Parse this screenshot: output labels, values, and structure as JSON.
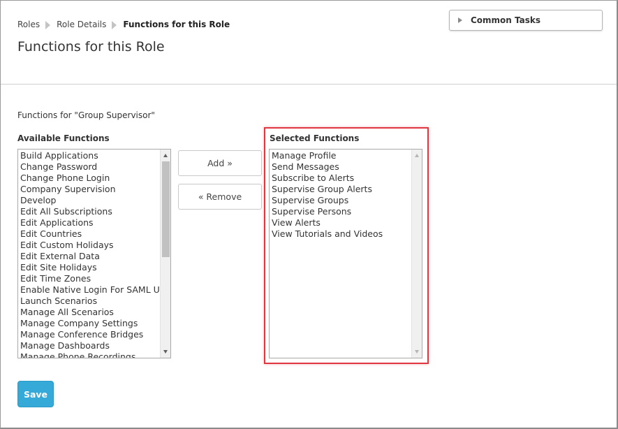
{
  "breadcrumb": {
    "items": [
      "Roles",
      "Role Details"
    ],
    "current": "Functions for this Role"
  },
  "page_title": "Functions for this Role",
  "common_tasks": {
    "label": "Common Tasks"
  },
  "functions_for_label": "Functions for \"Group Supervisor\"",
  "available": {
    "label": "Available Functions",
    "items": [
      "Build Applications",
      "Change Password",
      "Change Phone Login",
      "Company Supervision",
      "Develop",
      "Edit All Subscriptions",
      "Edit Applications",
      "Edit Countries",
      "Edit Custom Holidays",
      "Edit External Data",
      "Edit Site Holidays",
      "Edit Time Zones",
      "Enable Native Login For SAML Users",
      "Launch Scenarios",
      "Manage All Scenarios",
      "Manage Company Settings",
      "Manage Conference Bridges",
      "Manage Dashboards",
      "Manage Phone Recordings"
    ]
  },
  "buttons": {
    "add": "Add »",
    "remove": "« Remove",
    "save": "Save"
  },
  "selected": {
    "label": "Selected Functions",
    "items": [
      "Manage Profile",
      "Send Messages",
      "Subscribe to Alerts",
      "Supervise Group Alerts",
      "Supervise Groups",
      "Supervise Persons",
      "View Alerts",
      "View Tutorials and Videos"
    ]
  },
  "colors": {
    "accent": "#35a9d8",
    "highlight": "#e0363f"
  }
}
